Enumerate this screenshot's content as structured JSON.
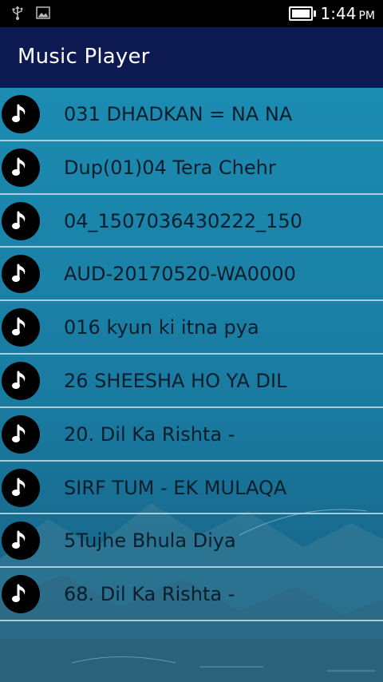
{
  "status_bar": {
    "time": "1:44",
    "ampm": "PM",
    "battery_level": 0.9,
    "left_icons": [
      "usb-icon",
      "image-icon"
    ]
  },
  "app_bar": {
    "title": "Music Player",
    "color": "#0d1a52"
  },
  "songs": [
    {
      "title": "031 DHADKAN = NA NA"
    },
    {
      "title": "Dup(01)04 Tera Chehr"
    },
    {
      "title": "04_1507036430222_150"
    },
    {
      "title": "AUD-20170520-WA0000"
    },
    {
      "title": "016 kyun ki itna pya"
    },
    {
      "title": "26 SHEESHA HO YA DIL"
    },
    {
      "title": "20. Dil Ka Rishta -"
    },
    {
      "title": "SIRF TUM - EK MULAQA"
    },
    {
      "title": "5Tujhe Bhula Diya"
    },
    {
      "title": "68. Dil Ka Rishta -"
    }
  ],
  "row_icon": "music-note-icon",
  "theme": {
    "background": "#1b8ab0",
    "divider": "#bedce8",
    "text": "#0c1d2b"
  }
}
